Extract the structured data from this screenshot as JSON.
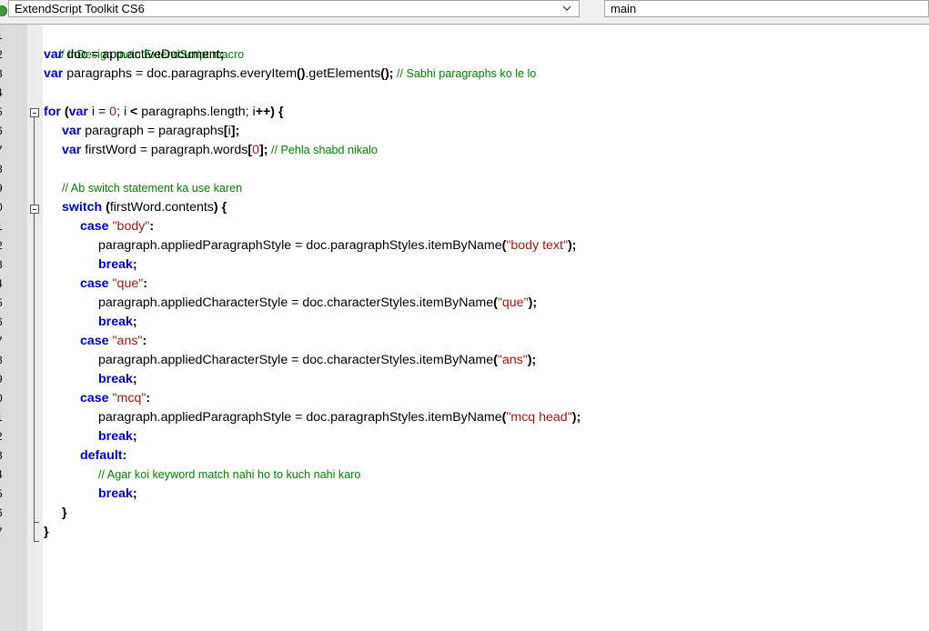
{
  "toolbar": {
    "target_app": "ExtendScript Toolkit CS6",
    "function_name": "main"
  },
  "line_numbers": [
    "1",
    "2",
    "3",
    "4",
    "5",
    "6",
    "7",
    "8",
    "9",
    "0",
    "1",
    "2",
    "3",
    "4",
    "5",
    "6",
    "7",
    "8",
    "9",
    "0",
    "1",
    "2",
    "3",
    "4",
    "5",
    "6",
    "7"
  ],
  "code": {
    "l1_comment": "// InDesign mein ExtendScript macro",
    "l2_kw": "var",
    "l2_rest": " doc = app.activeDocument",
    "l2_end": ";",
    "l3_kw": "var",
    "l3_a": " paragraphs = doc.paragraphs.everyItem",
    "l3_b": "()",
    "l3_c": ".getElements",
    "l3_d": "();",
    "l3_comment": " // Sabhi paragraphs ko le lo",
    "l5_kw1": "for",
    "l5_p1": " (",
    "l5_kw2": "var",
    "l5_a": " i = ",
    "l5_num": "0",
    "l5_b": "; i ",
    "l5_lt": "<",
    "l5_c": " paragraphs.length; i",
    "l5_inc": "++",
    "l5_d": ") {",
    "l6_kw": "var",
    "l6_a": " paragraph = paragraphs",
    "l6_b": "[",
    "l6_c": "i",
    "l6_d": "];",
    "l7_kw": "var",
    "l7_a": " firstWord = paragraph.words",
    "l7_b": "[",
    "l7_num": "0",
    "l7_c": "];",
    "l7_comment": " // Pehla shabd nikalo",
    "l9_comment": "// Ab switch statement ka use karen",
    "l10_kw": "switch",
    "l10_a": " (",
    "l10_b": "firstWord.contents",
    "l10_c": ") {",
    "case_kw": "case",
    "break_kw": "break",
    "semi": ";",
    "colon": ":",
    "l11_str": "\"body\"",
    "l12_a": "paragraph.appliedParagraphStyle = doc.paragraphStyles.itemByName",
    "l12_str": "\"body text\"",
    "l14_str": "\"que\"",
    "l15_a": "paragraph.appliedCharacterStyle = doc.characterStyles.itemByName",
    "l15_str": "\"que\"",
    "l17_str": "\"ans\"",
    "l18_a": "paragraph.appliedCharacterStyle = doc.characterStyles.itemByName",
    "l18_str": "\"ans\"",
    "l20_str": "\"mcq\"",
    "l21_a": "paragraph.appliedParagraphStyle = doc.paragraphStyles.itemByName",
    "l21_str": "\"mcq head\"",
    "default_kw": "default",
    "l24_comment": "// Agar koi keyword match nahi ho to kuch nahi karo",
    "open_paren": "(",
    "close_paren_semi": ");",
    "close_brace": "}"
  },
  "colors": {
    "keyword": "#0000cc",
    "string": "#a31515",
    "comment": "#008000"
  },
  "icons": [
    "target-app-icon",
    "chevron-down-icon",
    "fold-collapse-icon"
  ]
}
